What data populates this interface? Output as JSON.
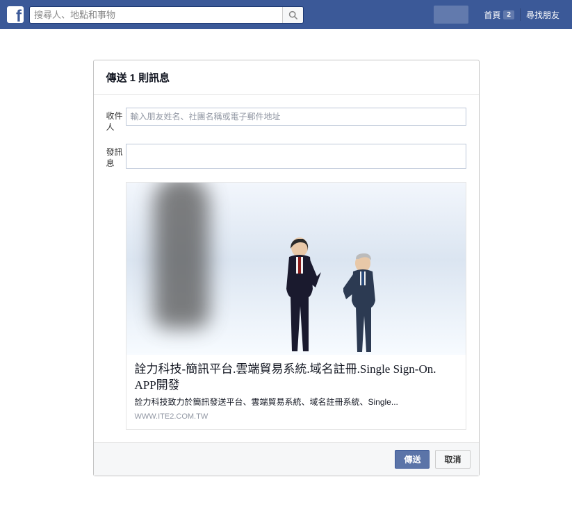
{
  "nav": {
    "search_placeholder": "搜尋人、地點和事物",
    "home_label": "首頁",
    "home_badge": "2",
    "find_friends_label": "尋找朋友"
  },
  "dialog": {
    "title": "傳送 1 則訊息",
    "recipient_label": "收件人",
    "recipient_placeholder": "輸入朋友姓名、社團名稱或電子郵件地址",
    "message_label": "發訊息",
    "message_value": "",
    "attachment": {
      "title": "詮力科技-簡訊平台.雲端貿易系統.域名註冊.Single Sign-On. APP開發",
      "description": "詮力科技致力於簡訊發送平台、雲端貿易系統、域名註冊系統、Single...",
      "domain": "WWW.ITE2.COM.TW"
    },
    "send_label": "傳送",
    "cancel_label": "取消"
  }
}
